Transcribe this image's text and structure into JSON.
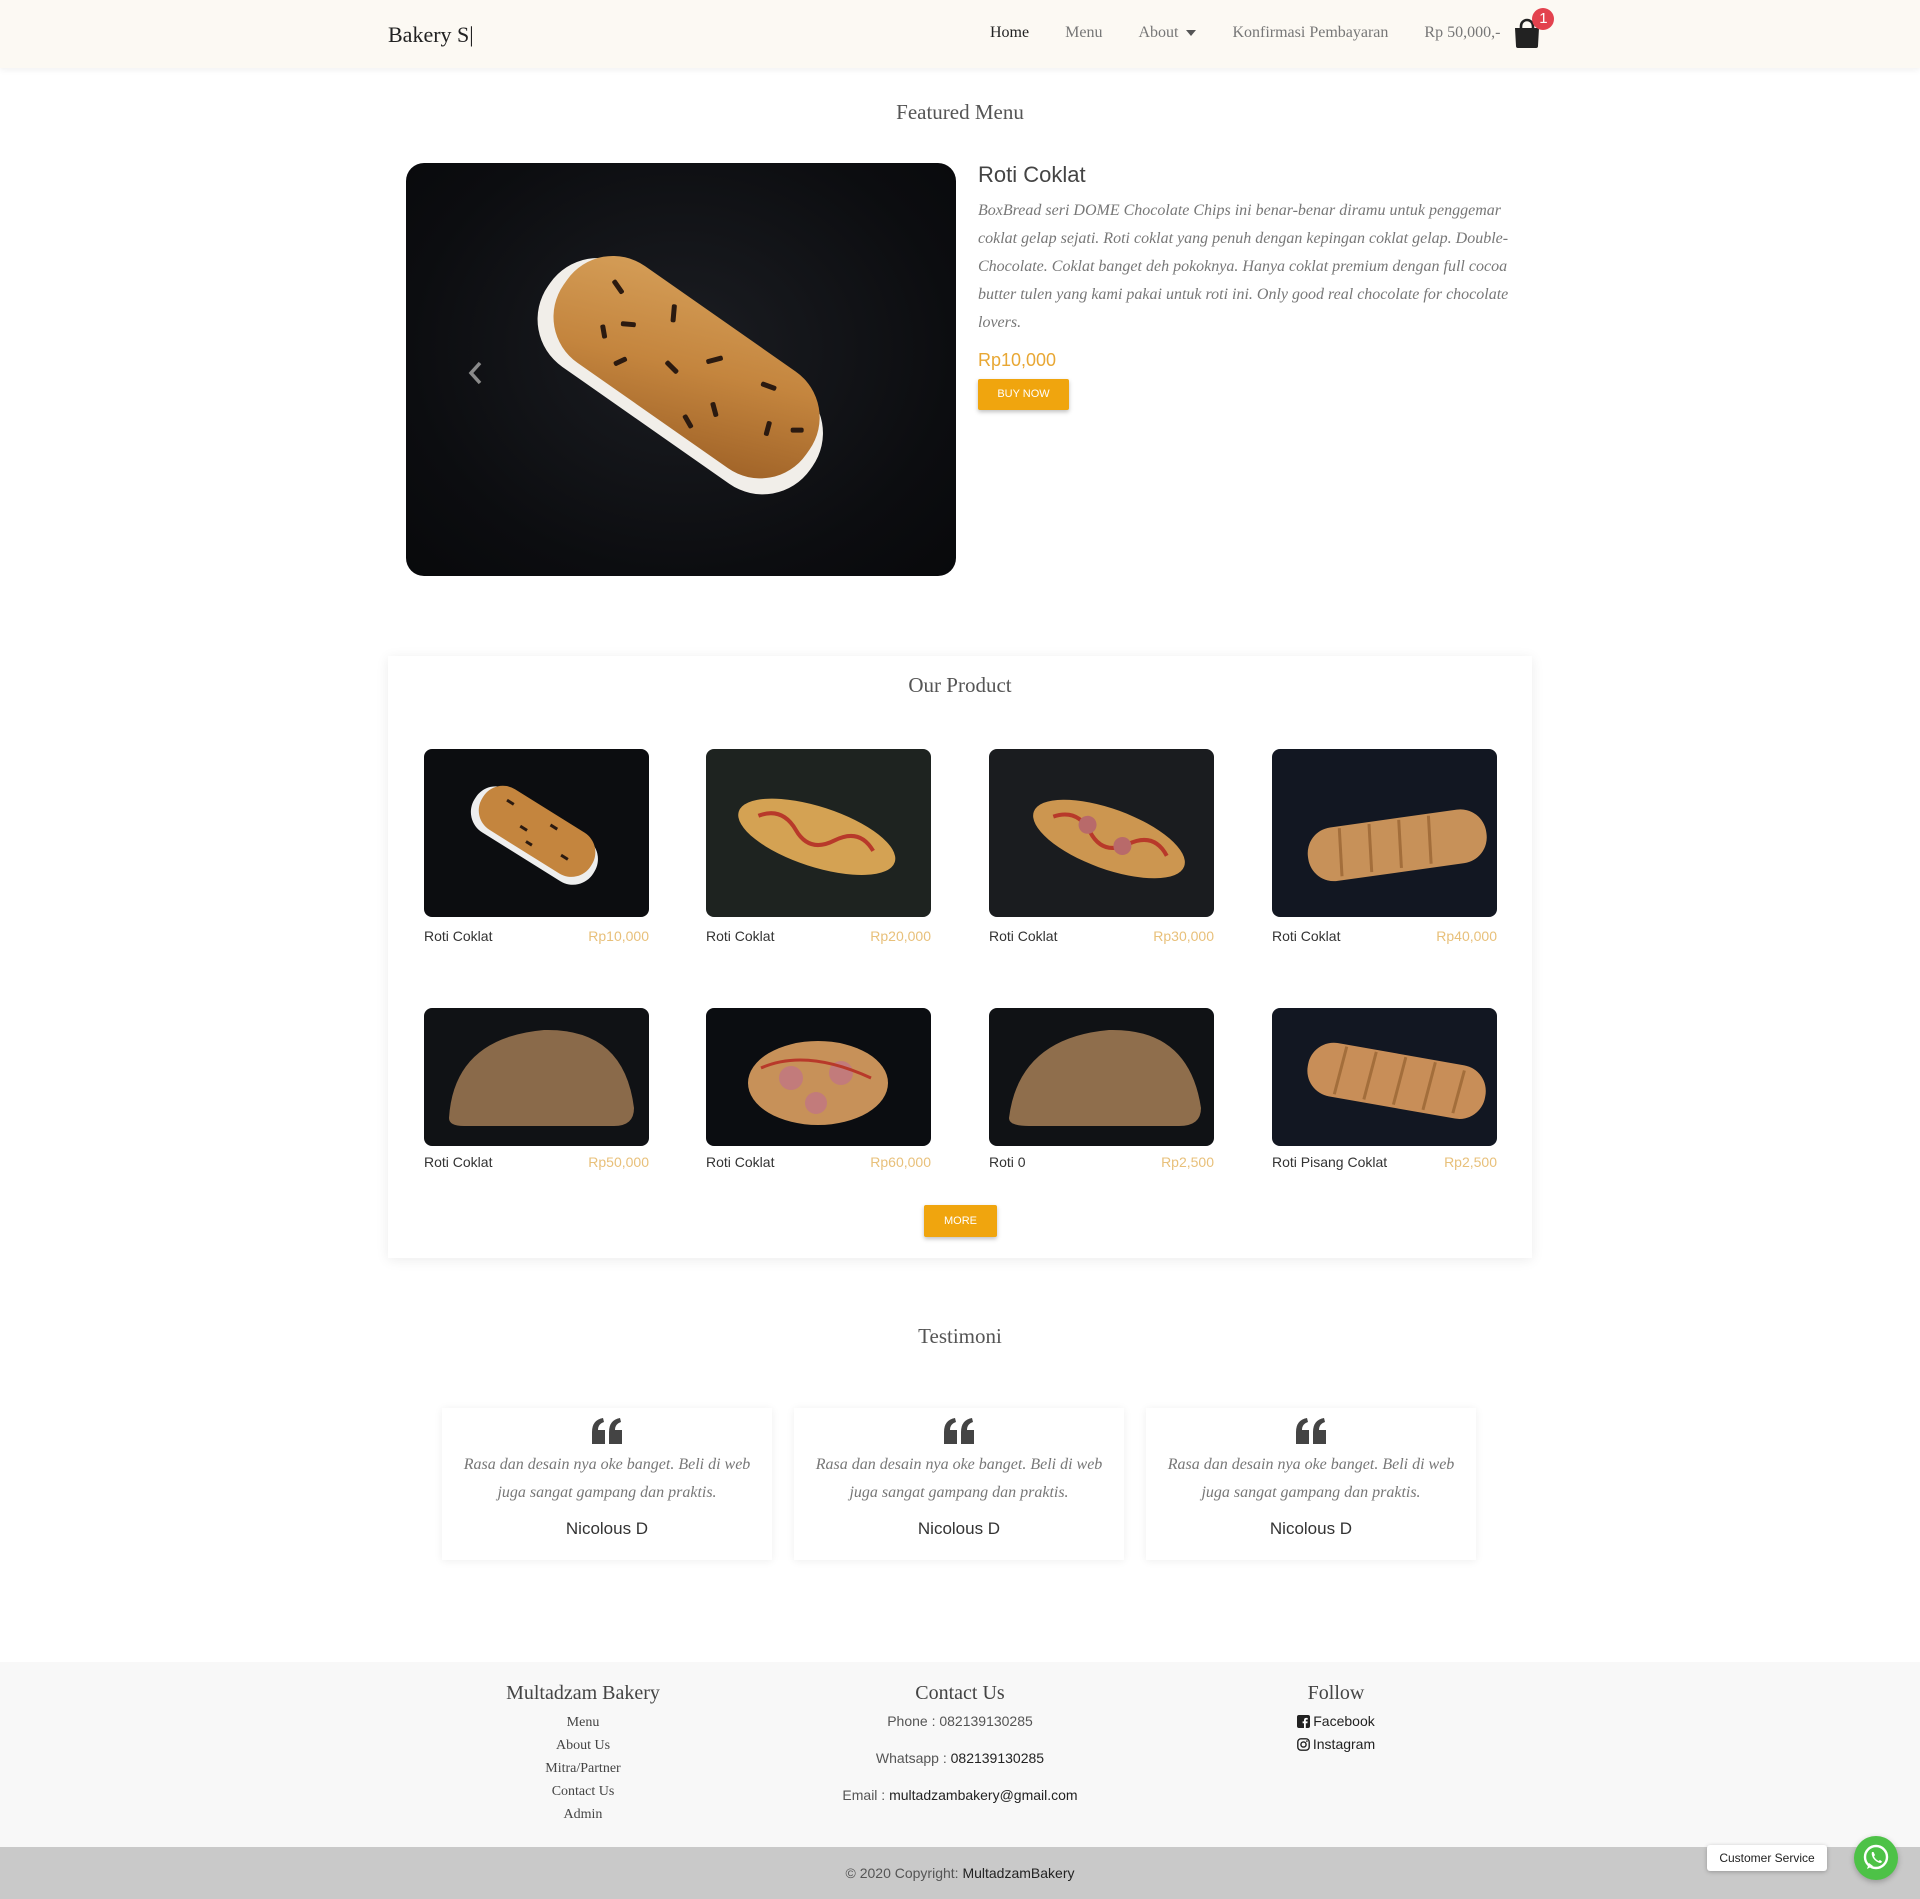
{
  "navbar": {
    "brand": "Bakery S|",
    "links": [
      {
        "label": "Home",
        "active": true
      },
      {
        "label": "Menu",
        "active": false
      },
      {
        "label": "About",
        "active": false,
        "dropdown": true
      },
      {
        "label": "Konfirmasi Pembayaran",
        "active": false
      }
    ],
    "cart_total": "Rp 50,000,-",
    "cart_count": "1"
  },
  "featured": {
    "section_title": "Featured Menu",
    "title": "Roti Coklat",
    "description": "BoxBread seri DOME Chocolate Chips ini benar-benar diramu untuk penggemar coklat gelap sejati. Roti coklat yang penuh dengan kepingan coklat gelap. Double-Chocolate. Coklat banget deh pokoknya. Hanya coklat premium dengan full cocoa butter tulen yang kami pakai untuk roti ini. Only good real chocolate for chocolate lovers.",
    "price": "Rp10,000",
    "buy_label": "BUY NOW"
  },
  "products": {
    "section_title": "Our Product",
    "items": [
      {
        "name": "Roti Coklat",
        "price": "Rp10,000"
      },
      {
        "name": "Roti Coklat",
        "price": "Rp20,000"
      },
      {
        "name": "Roti Coklat",
        "price": "Rp30,000"
      },
      {
        "name": "Roti Coklat",
        "price": "Rp40,000"
      },
      {
        "name": "Roti Coklat",
        "price": "Rp50,000"
      },
      {
        "name": "Roti Coklat",
        "price": "Rp60,000"
      },
      {
        "name": "Roti 0",
        "price": "Rp2,500"
      },
      {
        "name": "Roti Pisang Coklat",
        "price": "Rp2,500"
      }
    ],
    "more_label": "MORE"
  },
  "testimoni": {
    "section_title": "Testimoni",
    "items": [
      {
        "text": "Rasa dan desain nya oke banget. Beli di web juga sangat gampang dan praktis.",
        "name": "Nicolous D"
      },
      {
        "text": "Rasa dan desain nya oke banget. Beli di web juga sangat gampang dan praktis.",
        "name": "Nicolous D"
      },
      {
        "text": "Rasa dan desain nya oke banget. Beli di web juga sangat gampang dan praktis.",
        "name": "Nicolous D"
      }
    ]
  },
  "footer": {
    "col1_title": "Multadzam Bakery",
    "links": [
      "Menu",
      "About Us",
      "Mitra/Partner",
      "Contact Us",
      "Admin"
    ],
    "col2_title": "Contact Us",
    "phone_label": "Phone : ",
    "phone": "082139130285",
    "whatsapp_label": "Whatsapp : ",
    "whatsapp": "082139130285",
    "email_label": "Email : ",
    "email": "multadzambakery@gmail.com",
    "col3_title": "Follow",
    "facebook": "Facebook",
    "instagram": "Instagram",
    "copyright_prefix": "© 2020 Copyright: ",
    "copyright_name": "MultadzamBakery"
  },
  "customer_service": {
    "label": "Customer Service"
  },
  "colors": {
    "accent": "#f0a50e",
    "price": "#e8a733",
    "badge": "#e3424e",
    "whatsapp": "#4dc247"
  }
}
